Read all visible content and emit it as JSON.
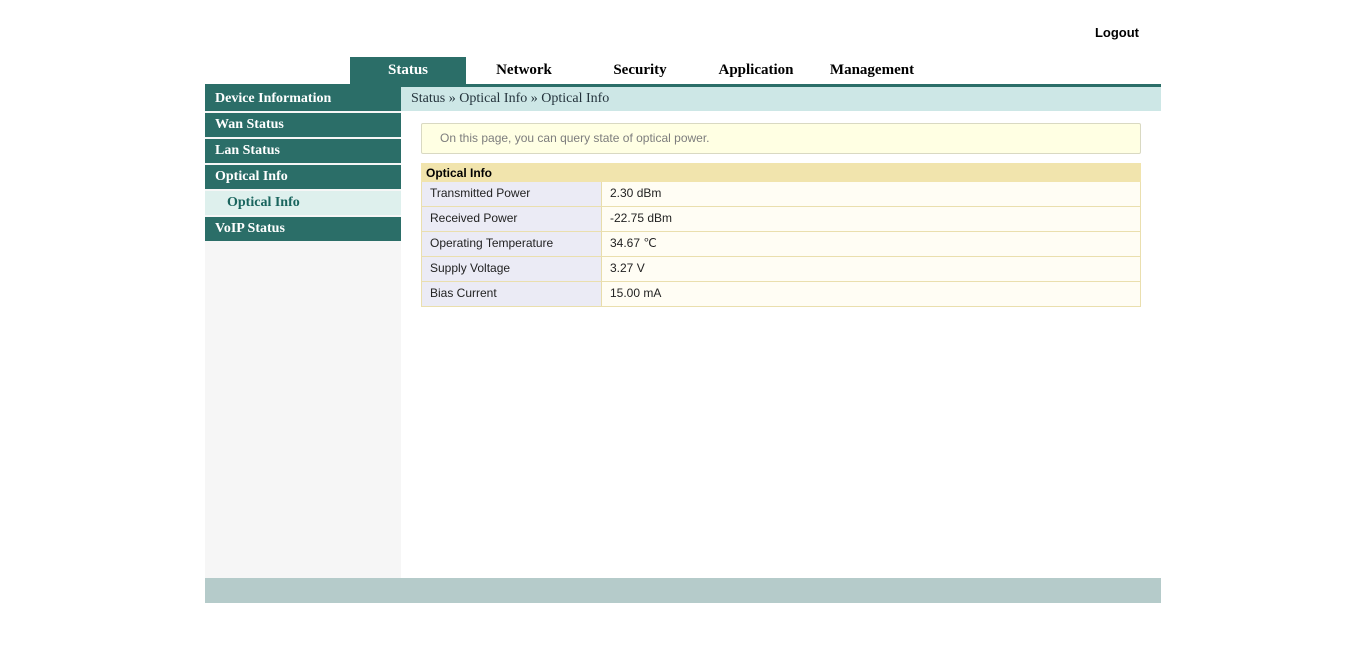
{
  "header": {
    "logout_label": "Logout",
    "tabs": [
      {
        "label": "Status",
        "active": true
      },
      {
        "label": "Network",
        "active": false
      },
      {
        "label": "Security",
        "active": false
      },
      {
        "label": "Application",
        "active": false
      },
      {
        "label": "Management",
        "active": false
      }
    ]
  },
  "sidebar": {
    "items": [
      {
        "label": "Device Information",
        "level": "main",
        "selected": false
      },
      {
        "label": "Wan Status",
        "level": "main",
        "selected": false
      },
      {
        "label": "Lan Status",
        "level": "main",
        "selected": false
      },
      {
        "label": "Optical Info",
        "level": "main",
        "selected": false
      },
      {
        "label": "Optical Info",
        "level": "sub",
        "selected": true
      },
      {
        "label": "VoIP Status",
        "level": "main",
        "selected": false
      }
    ]
  },
  "breadcrumb": "Status » Optical Info » Optical Info",
  "main": {
    "note": "On this page, you can query state of optical power.",
    "table": {
      "title": "Optical Info",
      "rows": [
        {
          "label": "Transmitted Power",
          "value": "2.30 dBm"
        },
        {
          "label": "Received Power",
          "value": "-22.75 dBm"
        },
        {
          "label": "Operating Temperature",
          "value": "34.67 ℃"
        },
        {
          "label": "Supply Voltage",
          "value": "3.27 V"
        },
        {
          "label": "Bias Current",
          "value": "15.00 mA"
        }
      ]
    }
  },
  "colors": {
    "accent_teal": "#2b6e68",
    "breadcrumb_bg": "#cde7e6",
    "selected_subitem_bg": "#def0ed",
    "note_bg": "#ffffe3",
    "table_header_bg": "#f1e4ad",
    "table_label_bg": "#ebebf5",
    "table_value_bg": "#fffdf4",
    "footer_bg": "#b5cbca",
    "sidebar_filler_bg": "#f6f6f6"
  }
}
